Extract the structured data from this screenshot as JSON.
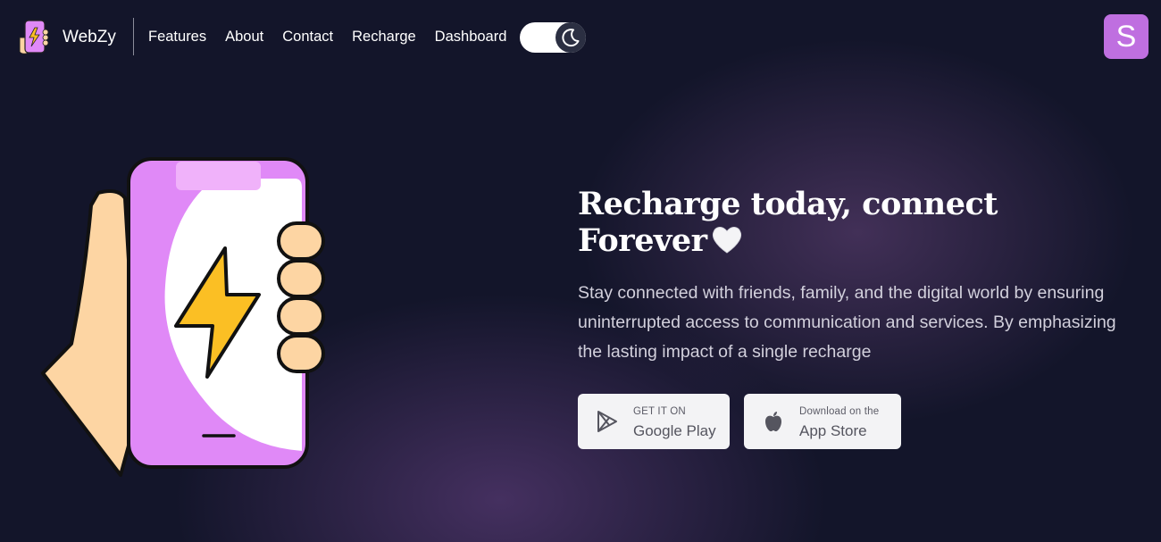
{
  "nav": {
    "brand": "WebZy",
    "links": [
      "Features",
      "About",
      "Contact",
      "Recharge",
      "Dashboard"
    ],
    "avatar_letter": "S",
    "theme": "dark"
  },
  "hero": {
    "title_line1": "Recharge today, connect",
    "title_line2": "Forever",
    "description": "Stay connected with friends, family, and the digital world by ensuring uninterrupted access to communication and services. By emphasizing the lasting impact of a single recharge"
  },
  "stores": {
    "google": {
      "small": "GET IT ON",
      "big": "Google Play",
      "icon": "play-store-icon"
    },
    "apple": {
      "small": "Download on the",
      "big": "App Store",
      "icon": "apple-icon"
    }
  },
  "colors": {
    "background": "#13152a",
    "accent": "#bf6fe0",
    "phone": "#e089f7",
    "bolt": "#fbbf24",
    "skin": "#fdd5a3"
  }
}
